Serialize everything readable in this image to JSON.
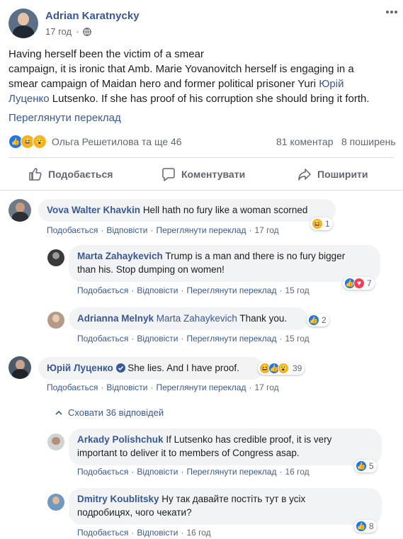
{
  "post": {
    "author": "Adrian Karatnycky",
    "time": "17 год",
    "text_line1": "Having herself been the victim of a smear",
    "text_line2": "campaign, it is ironic that Amb. Marie Yovanovitch herself is engaging in a",
    "text_line3": "smear campaign of Maidan hero and former political prisoner Yuri ",
    "text_link1": "Юрій",
    "text_link2": "Луценко",
    "text_line4": " Lutsenko. If she has proof of his corruption she should bring it forth.",
    "translate": "Переглянути переклад",
    "reactors": "Ольга Решетилова та ще 46",
    "comments_count": "81 коментар",
    "shares_count": "8 поширень"
  },
  "actionbar": {
    "like": "Подобається",
    "comment": "Коментувати",
    "share": "Поширити"
  },
  "labels": {
    "like": "Подобається",
    "reply": "Відповісти",
    "translate": "Переглянути переклад",
    "hide_replies": "Сховати 36 відповідей"
  },
  "comments": [
    {
      "name": "Vova Walter Khavkin",
      "text": "Hell hath no fury like a woman scorned",
      "time": "17 год",
      "reactions": "1"
    },
    {
      "name": "Marta Zahaykevich",
      "text_a": "Trump is a man and there is no fury bigger",
      "text_b": "than his. Stop dumping on women!",
      "time": "15 год",
      "reactions": "7"
    },
    {
      "name": "Adrianna Melnyk",
      "mention": "Marta Zahaykevich",
      "text": "Thank you.",
      "time": "15 год",
      "reactions": "2"
    },
    {
      "name": "Юрій Луценко",
      "text": "She lies. And I have proof.",
      "time": "17 год",
      "reactions": "39"
    },
    {
      "name": "Arkady Polishchuk",
      "text_a": "If Lutsenko has credible proof, it is very",
      "text_b": "important to deliver it to members of Congress asap.",
      "time": "16 год",
      "reactions": "5"
    },
    {
      "name": "Dmitry Koublitsky",
      "text_a": "Ну так давайте постіть тут в усіх",
      "text_b": "подробицях, чого чекати?",
      "time": "16 год",
      "reactions": "8"
    }
  ],
  "colors": {
    "link": "#385898",
    "meta": "#606770",
    "bubble": "#f2f3f5",
    "like": "#1877f2"
  },
  "icons": [
    "globe-icon",
    "chevron-down-icon",
    "thumbs-up-icon",
    "comment-icon",
    "share-icon",
    "verified-icon",
    "chevron-up-icon"
  ]
}
